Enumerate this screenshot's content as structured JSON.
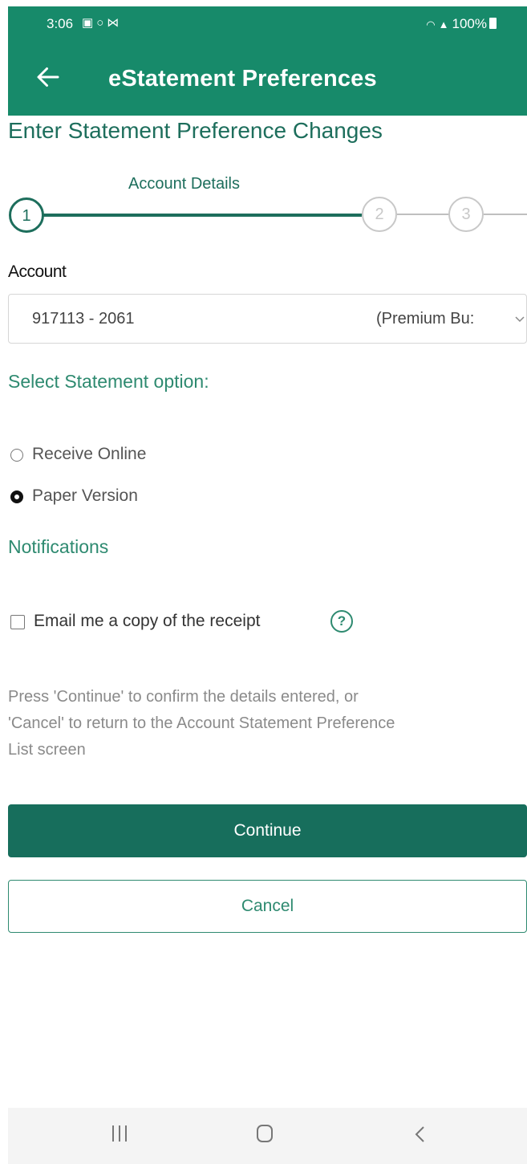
{
  "status_bar": {
    "time": "3:06",
    "left_icons": [
      "image-icon",
      "circle-icon",
      "mail-icon"
    ],
    "signal_icons": [
      "wifi-icon",
      "signal-icon"
    ],
    "battery": "100%"
  },
  "toolbar": {
    "back_icon": "back-arrow-icon",
    "title": "eStatement Preferences"
  },
  "page": {
    "heading": "Enter Statement Preference Changes"
  },
  "stepper": {
    "active_label": "Account Details",
    "steps": [
      "1",
      "2",
      "3"
    ],
    "current_step": 1
  },
  "account": {
    "label": "Account",
    "number": "917113 - 2061",
    "type": "(Premium Bu:"
  },
  "statement_option": {
    "heading": "Select Statement option:",
    "options": [
      {
        "label": "Receive Online",
        "selected": false
      },
      {
        "label": "Paper Version",
        "selected": true
      }
    ]
  },
  "notifications": {
    "heading": "Notifications",
    "email_receipt_label": "Email me a copy of the receipt",
    "email_receipt_checked": false,
    "help_icon": "?"
  },
  "instructions": {
    "line1": "Press 'Continue' to confirm the details entered, or",
    "line2": "'Cancel' to return to the Account Statement Preference",
    "line3": "List screen"
  },
  "buttons": {
    "continue": "Continue",
    "cancel": "Cancel"
  },
  "colors": {
    "brand_green": "#178a6a",
    "dark_green": "#176e5c",
    "accent_green": "#2e8a70"
  },
  "nav_bar": {
    "icons": [
      "recents-icon",
      "home-icon",
      "back-icon"
    ]
  }
}
